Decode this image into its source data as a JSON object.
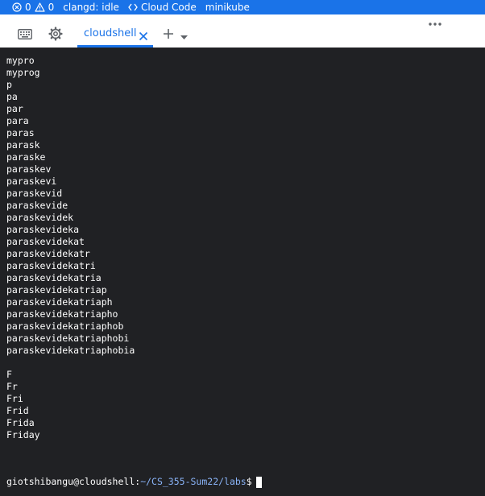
{
  "statusbar": {
    "errors_count": "0",
    "warnings_count": "0",
    "clangd_status": "clangd: idle",
    "cloud_code_label": "Cloud Code",
    "minikube_label": "minikube",
    "background_color": "#1a73e8"
  },
  "tabbar": {
    "keyboard_icon": "keyboard-icon",
    "settings_icon": "gear-icon",
    "active_tab_label": "cloudshell",
    "close_icon": "close-icon",
    "add_icon": "plus-icon",
    "dropdown_icon": "chevron-down-icon",
    "more_icon": "more-horizontal-icon",
    "accent_color": "#1a73e8"
  },
  "terminal": {
    "background_color": "#202124",
    "lines": [
      "mypro",
      "myprog",
      "p",
      "pa",
      "par",
      "para",
      "paras",
      "parask",
      "paraske",
      "paraskev",
      "paraskevi",
      "paraskevid",
      "paraskevide",
      "paraskevidek",
      "paraskevideka",
      "paraskevidekat",
      "paraskevidekatr",
      "paraskevidekatri",
      "paraskevidekatria",
      "paraskevidekatriap",
      "paraskevidekatriaph",
      "paraskevidekatriapho",
      "paraskevidekatriaphob",
      "paraskevidekatriaphobi",
      "paraskevidekatriaphobia",
      "",
      "F",
      "Fr",
      "Fri",
      "Frid",
      "Frida",
      "Friday"
    ],
    "prompt": {
      "user_host": "giotshibangu@cloudshell",
      "separator": ":",
      "path": "~/CS_355-Sum22/labs",
      "symbol": "$",
      "path_color": "#8ab4f8"
    }
  }
}
